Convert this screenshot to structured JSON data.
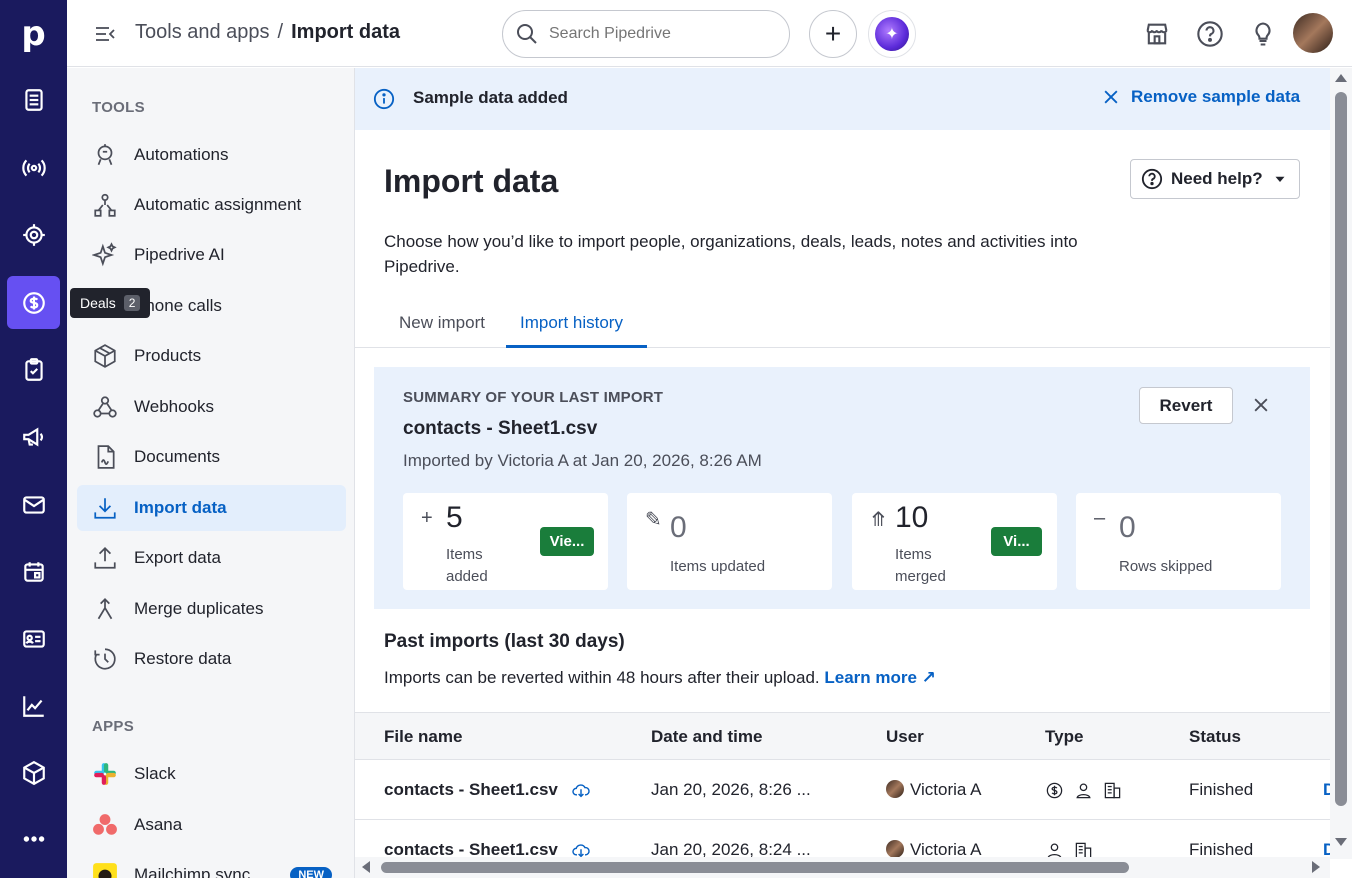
{
  "rail": {
    "logo": "p",
    "tooltip": {
      "label": "Deals",
      "count": "2"
    }
  },
  "topbar": {
    "breadcrumb_parent": "Tools and apps",
    "breadcrumb_sep": "/",
    "breadcrumb_current": "Import data",
    "search_placeholder": "Search Pipedrive",
    "add_symbol": "+"
  },
  "tools": {
    "section_tools": "TOOLS",
    "items": [
      {
        "label": "Automations",
        "icon": "automations-icon"
      },
      {
        "label": "Automatic assignment",
        "icon": "assignment-icon"
      },
      {
        "label": "Pipedrive AI",
        "icon": "sparkle-icon"
      },
      {
        "label": "Phone calls",
        "icon": "phone-icon"
      },
      {
        "label": "Products",
        "icon": "box-icon"
      },
      {
        "label": "Webhooks",
        "icon": "webhook-icon"
      },
      {
        "label": "Documents",
        "icon": "document-icon"
      },
      {
        "label": "Import data",
        "icon": "download-icon"
      },
      {
        "label": "Export data",
        "icon": "upload-icon"
      },
      {
        "label": "Merge duplicates",
        "icon": "merge-icon"
      },
      {
        "label": "Restore data",
        "icon": "restore-icon"
      }
    ],
    "section_apps": "APPS",
    "apps": [
      {
        "label": "Slack"
      },
      {
        "label": "Asana"
      },
      {
        "label": "Mailchimp sync",
        "badge": "NEW"
      }
    ]
  },
  "banner": {
    "text": "Sample data added",
    "action": "Remove sample data"
  },
  "page": {
    "title": "Import data",
    "help": "Need help?",
    "description": "Choose how you’d like to import people, organizations, deals, leads, notes and activities into Pipedrive.",
    "tabs": [
      "New import",
      "Import history"
    ]
  },
  "summary": {
    "label": "SUMMARY OF YOUR LAST IMPORT",
    "file": "contacts - Sheet1.csv",
    "imported_by": "Imported by Victoria A at Jan 20, 2026, 8:26 AM",
    "revert": "Revert",
    "stats": [
      {
        "symbol": "+",
        "value": "5",
        "label": "Items added",
        "button": "Vie..."
      },
      {
        "symbol": "✎",
        "value": "0",
        "label": "Items updated"
      },
      {
        "symbol": "⤊",
        "value": "10",
        "label": "Items merged",
        "button": "Vi..."
      },
      {
        "symbol": "–",
        "value": "0",
        "label": "Rows skipped"
      }
    ]
  },
  "past": {
    "title": "Past imports (last 30 days)",
    "note": "Imports can be reverted within 48 hours after their upload.",
    "learn_more": "Learn more ↗"
  },
  "table": {
    "headers": [
      "File name",
      "Date and time",
      "User",
      "Type",
      "Status"
    ],
    "rows": [
      {
        "file": "contacts - Sheet1.csv",
        "date": "Jan 20, 2026, 8:26 ...",
        "user": "Victoria A",
        "status": "Finished",
        "trailing": "D"
      },
      {
        "file": "contacts - Sheet1.csv",
        "date": "Jan 20, 2026, 8:24 ...",
        "user": "Victoria A",
        "status": "Finished",
        "trailing": "D"
      }
    ]
  },
  "colors": {
    "rail": "#1a1a5e",
    "accent": "#6650f2",
    "link": "#0761c4",
    "success": "#1a7d3b"
  }
}
